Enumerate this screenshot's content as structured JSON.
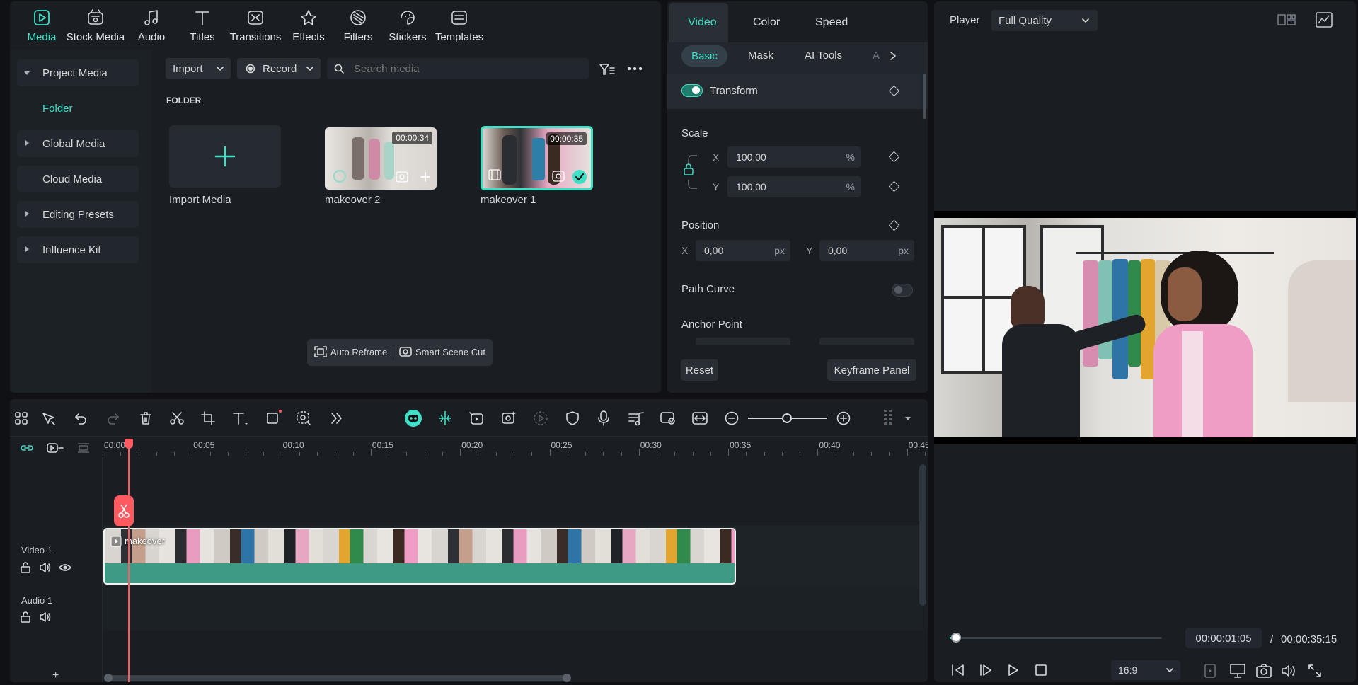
{
  "toolbar": {
    "items": [
      {
        "label": "Media",
        "icon": "media-icon",
        "active": true
      },
      {
        "label": "Stock Media",
        "icon": "stock-media-icon"
      },
      {
        "label": "Audio",
        "icon": "audio-icon"
      },
      {
        "label": "Titles",
        "icon": "titles-icon"
      },
      {
        "label": "Transitions",
        "icon": "transitions-icon"
      },
      {
        "label": "Effects",
        "icon": "effects-icon"
      },
      {
        "label": "Filters",
        "icon": "filters-icon"
      },
      {
        "label": "Stickers",
        "icon": "stickers-icon"
      },
      {
        "label": "Templates",
        "icon": "templates-icon"
      }
    ]
  },
  "sidebar": {
    "items": [
      {
        "label": "Project Media",
        "expanded": true
      },
      {
        "label": "Folder"
      },
      {
        "label": "Global Media"
      },
      {
        "label": "Cloud Media"
      },
      {
        "label": "Editing Presets"
      },
      {
        "label": "Influence Kit"
      }
    ]
  },
  "media": {
    "import_label": "Import",
    "record_label": "Record",
    "search_placeholder": "Search media",
    "folder_heading": "FOLDER",
    "import_media_label": "Import Media",
    "clips": [
      {
        "name": "makeover 2",
        "duration": "00:00:34",
        "selected": false
      },
      {
        "name": "makeover 1",
        "duration": "00:00:35",
        "selected": true
      }
    ],
    "auto_reframe": "Auto Reframe",
    "smart_scene_cut": "Smart Scene Cut"
  },
  "properties": {
    "tabs": [
      "Video",
      "Color",
      "Speed"
    ],
    "active_tab": "Video",
    "subtabs": [
      "Basic",
      "Mask",
      "AI Tools",
      "A"
    ],
    "active_subtab": "Basic",
    "transform_label": "Transform",
    "scale_label": "Scale",
    "scale_x_axis": "X",
    "scale_x": "100,00",
    "scale_y_axis": "Y",
    "scale_y": "100,00",
    "percent_unit": "%",
    "position_label": "Position",
    "pos_x_axis": "X",
    "pos_x": "0,00",
    "pos_y_axis": "Y",
    "pos_y": "0,00",
    "px_unit": "px",
    "path_curve_label": "Path Curve",
    "anchor_point_label": "Anchor Point",
    "reset_label": "Reset",
    "keyframe_panel_label": "Keyframe Panel"
  },
  "player": {
    "label": "Player",
    "quality": "Full Quality",
    "current_time": "00:00:01:05",
    "separator": "/",
    "total_time": "00:00:35:15",
    "aspect_ratio": "16:9",
    "progress": 0.03
  },
  "timeline": {
    "ruler": [
      "00:00",
      "00:05",
      "00:10",
      "00:15",
      "00:20",
      "00:25",
      "00:30",
      "00:35",
      "00:40",
      "00:45"
    ],
    "video_track": "Video 1",
    "audio_track": "Audio 1",
    "clip_name": "makeover",
    "add_track_symbol": "+"
  },
  "colors": {
    "accent": "#3fe0c5",
    "clip_green": "#3e9a84",
    "playhead": "#ff5a5f"
  }
}
